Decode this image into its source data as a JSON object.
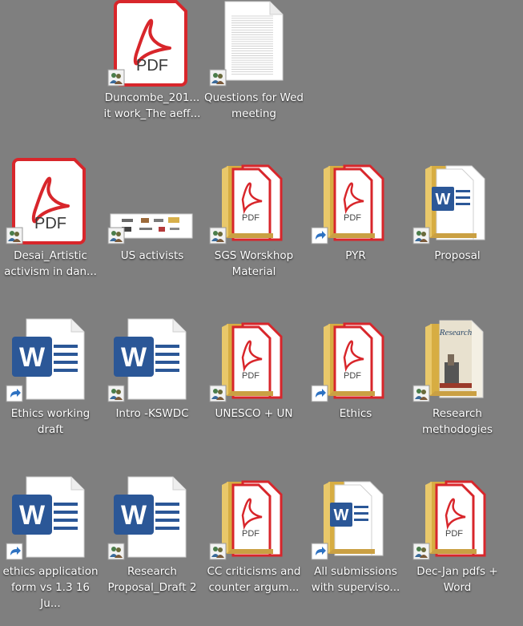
{
  "desktop": {
    "items": [
      {
        "kind": "pdf",
        "label": "Duncombe_201...\nit work_The aeff...",
        "overlay": "shared"
      },
      {
        "kind": "doc",
        "label": "Questions for Wed\nmeeting",
        "overlay": "shared"
      },
      {
        "kind": "pdf",
        "label": "Desai_Artistic\nactivism in dan...",
        "overlay": "shared"
      },
      {
        "kind": "image",
        "label": "US activists",
        "overlay": "shared"
      },
      {
        "kind": "folder-pdf",
        "label": "SGS Worskhop\nMaterial",
        "overlay": "shared"
      },
      {
        "kind": "folder-pdf",
        "label": "PYR",
        "overlay": "shortcut"
      },
      {
        "kind": "folder-word",
        "label": "Proposal",
        "overlay": "shared"
      },
      {
        "kind": "word",
        "label": "Ethics working\ndraft",
        "overlay": "shortcut"
      },
      {
        "kind": "word",
        "label": "Intro -KSWDC",
        "overlay": "shared"
      },
      {
        "kind": "folder-pdf",
        "label": "UNESCO + UN",
        "overlay": "shared"
      },
      {
        "kind": "folder-pdf",
        "label": "Ethics",
        "overlay": "shortcut"
      },
      {
        "kind": "folder-book",
        "label": "Research\nmethodogies",
        "overlay": "shared"
      },
      {
        "kind": "word",
        "label": "ethics application\nform vs 1.3 16 Ju...",
        "overlay": "shortcut"
      },
      {
        "kind": "word",
        "label": "Research\nProposal_Draft 2",
        "overlay": "shared"
      },
      {
        "kind": "folder-pdf",
        "label": "CC criticisms and\ncounter argum...",
        "overlay": "shared"
      },
      {
        "kind": "folder-word",
        "label": "All submissions\nwith superviso...",
        "overlay": "shortcut"
      },
      {
        "kind": "folder-pdf",
        "label": "Dec-Jan pdfs +\nWord",
        "overlay": "shared"
      }
    ],
    "icon_text": {
      "pdf": "PDF",
      "word": "W",
      "book": "Research"
    }
  },
  "colors": {
    "background": "#7f7f7f",
    "pdf_red": "#d8262b",
    "word_blue": "#2b5797",
    "folder_yellow": "#e9c86a",
    "shortcut_blue": "#2e72c2"
  }
}
